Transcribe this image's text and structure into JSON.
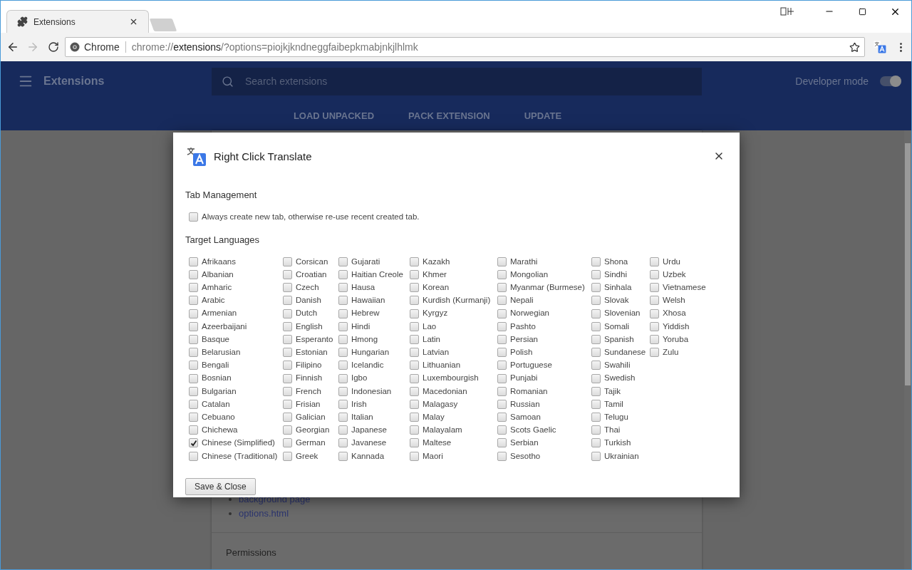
{
  "browser": {
    "tabs": [
      {
        "title": "Extensions",
        "selected": true
      }
    ],
    "site_label": "Chrome",
    "url_prefix": "chrome://",
    "url_host": "extensions",
    "url_rest": "/?options=piojkjkndneggfaibepkmabjnkjlhlmk"
  },
  "header": {
    "title": "Extensions",
    "search": {
      "placeholder": "Search extensions"
    },
    "developer_mode": {
      "label": "Developer mode",
      "on": true
    },
    "actions": [
      "LOAD UNPACKED",
      "PACK EXTENSION",
      "UPDATE"
    ]
  },
  "card": {
    "links": [
      "background page",
      "options.html"
    ],
    "section": "Permissions"
  },
  "dialog": {
    "title": "Right Click Translate",
    "tab_management": {
      "heading": "Tab Management",
      "option": {
        "label": "Always create new tab, otherwise re-use recent created tab.",
        "checked": false
      }
    },
    "languages_heading": "Target Languages",
    "language_columns": [
      [
        {
          "label": "Afrikaans",
          "checked": false
        },
        {
          "label": "Albanian",
          "checked": false
        },
        {
          "label": "Amharic",
          "checked": false
        },
        {
          "label": "Arabic",
          "checked": false
        },
        {
          "label": "Armenian",
          "checked": false
        },
        {
          "label": "Azeerbaijani",
          "checked": false
        },
        {
          "label": "Basque",
          "checked": false
        },
        {
          "label": "Belarusian",
          "checked": false
        },
        {
          "label": "Bengali",
          "checked": false
        },
        {
          "label": "Bosnian",
          "checked": false
        },
        {
          "label": "Bulgarian",
          "checked": false
        },
        {
          "label": "Catalan",
          "checked": false
        },
        {
          "label": "Cebuano",
          "checked": false
        },
        {
          "label": "Chichewa",
          "checked": false
        },
        {
          "label": "Chinese (Simplified)",
          "checked": true
        },
        {
          "label": "Chinese (Traditional)",
          "checked": false
        }
      ],
      [
        {
          "label": "Corsican",
          "checked": false
        },
        {
          "label": "Croatian",
          "checked": false
        },
        {
          "label": "Czech",
          "checked": false
        },
        {
          "label": "Danish",
          "checked": false
        },
        {
          "label": "Dutch",
          "checked": false
        },
        {
          "label": "English",
          "checked": false
        },
        {
          "label": "Esperanto",
          "checked": false
        },
        {
          "label": "Estonian",
          "checked": false
        },
        {
          "label": "Filipino",
          "checked": false
        },
        {
          "label": "Finnish",
          "checked": false
        },
        {
          "label": "French",
          "checked": false
        },
        {
          "label": "Frisian",
          "checked": false
        },
        {
          "label": "Galician",
          "checked": false
        },
        {
          "label": "Georgian",
          "checked": false
        },
        {
          "label": "German",
          "checked": false
        },
        {
          "label": "Greek",
          "checked": false
        }
      ],
      [
        {
          "label": "Gujarati",
          "checked": false
        },
        {
          "label": "Haitian Creole",
          "checked": false
        },
        {
          "label": "Hausa",
          "checked": false
        },
        {
          "label": "Hawaiian",
          "checked": false
        },
        {
          "label": "Hebrew",
          "checked": false
        },
        {
          "label": "Hindi",
          "checked": false
        },
        {
          "label": "Hmong",
          "checked": false
        },
        {
          "label": "Hungarian",
          "checked": false
        },
        {
          "label": "Icelandic",
          "checked": false
        },
        {
          "label": "Igbo",
          "checked": false
        },
        {
          "label": "Indonesian",
          "checked": false
        },
        {
          "label": "Irish",
          "checked": false
        },
        {
          "label": "Italian",
          "checked": false
        },
        {
          "label": "Japanese",
          "checked": false
        },
        {
          "label": "Javanese",
          "checked": false
        },
        {
          "label": "Kannada",
          "checked": false
        }
      ],
      [
        {
          "label": "Kazakh",
          "checked": false
        },
        {
          "label": "Khmer",
          "checked": false
        },
        {
          "label": "Korean",
          "checked": false
        },
        {
          "label": "Kurdish (Kurmanji)",
          "checked": false
        },
        {
          "label": "Kyrgyz",
          "checked": false
        },
        {
          "label": "Lao",
          "checked": false
        },
        {
          "label": "Latin",
          "checked": false
        },
        {
          "label": "Latvian",
          "checked": false
        },
        {
          "label": "Lithuanian",
          "checked": false
        },
        {
          "label": "Luxembourgish",
          "checked": false
        },
        {
          "label": "Macedonian",
          "checked": false
        },
        {
          "label": "Malagasy",
          "checked": false
        },
        {
          "label": "Malay",
          "checked": false
        },
        {
          "label": "Malayalam",
          "checked": false
        },
        {
          "label": "Maltese",
          "checked": false
        },
        {
          "label": "Maori",
          "checked": false
        }
      ],
      [
        {
          "label": "Marathi",
          "checked": false
        },
        {
          "label": "Mongolian",
          "checked": false
        },
        {
          "label": "Myanmar (Burmese)",
          "checked": false
        },
        {
          "label": "Nepali",
          "checked": false
        },
        {
          "label": "Norwegian",
          "checked": false
        },
        {
          "label": "Pashto",
          "checked": false
        },
        {
          "label": "Persian",
          "checked": false
        },
        {
          "label": "Polish",
          "checked": false
        },
        {
          "label": "Portuguese",
          "checked": false
        },
        {
          "label": "Punjabi",
          "checked": false
        },
        {
          "label": "Romanian",
          "checked": false
        },
        {
          "label": "Russian",
          "checked": false
        },
        {
          "label": "Samoan",
          "checked": false
        },
        {
          "label": "Scots Gaelic",
          "checked": false
        },
        {
          "label": "Serbian",
          "checked": false
        },
        {
          "label": "Sesotho",
          "checked": false
        }
      ],
      [
        {
          "label": "Shona",
          "checked": false
        },
        {
          "label": "Sindhi",
          "checked": false
        },
        {
          "label": "Sinhala",
          "checked": false
        },
        {
          "label": "Slovak",
          "checked": false
        },
        {
          "label": "Slovenian",
          "checked": false
        },
        {
          "label": "Somali",
          "checked": false
        },
        {
          "label": "Spanish",
          "checked": false
        },
        {
          "label": "Sundanese",
          "checked": false
        },
        {
          "label": "Swahili",
          "checked": false
        },
        {
          "label": "Swedish",
          "checked": false
        },
        {
          "label": "Tajik",
          "checked": false
        },
        {
          "label": "Tamil",
          "checked": false
        },
        {
          "label": "Telugu",
          "checked": false
        },
        {
          "label": "Thai",
          "checked": false
        },
        {
          "label": "Turkish",
          "checked": false
        },
        {
          "label": "Ukrainian",
          "checked": false
        }
      ],
      [
        {
          "label": "Urdu",
          "checked": false
        },
        {
          "label": "Uzbek",
          "checked": false
        },
        {
          "label": "Vietnamese",
          "checked": false
        },
        {
          "label": "Welsh",
          "checked": false
        },
        {
          "label": "Xhosa",
          "checked": false
        },
        {
          "label": "Yiddish",
          "checked": false
        },
        {
          "label": "Yoruba",
          "checked": false
        },
        {
          "label": "Zulu",
          "checked": false
        }
      ]
    ],
    "save_button": "Save & Close"
  }
}
